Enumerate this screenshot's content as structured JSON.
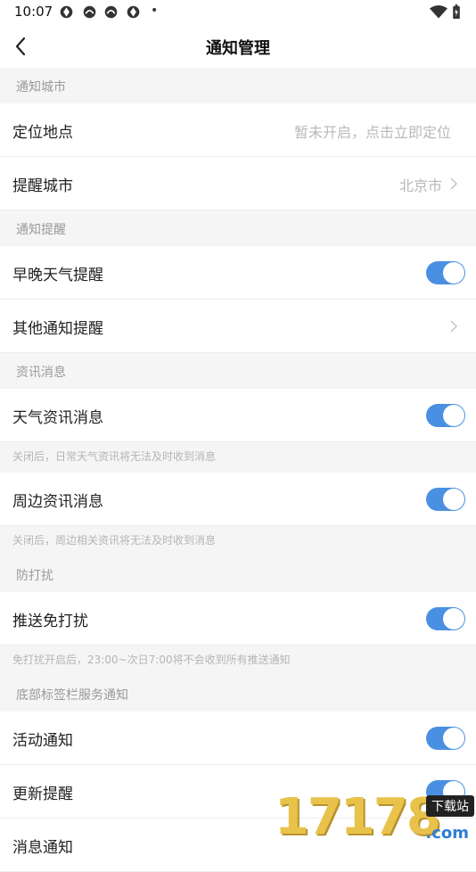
{
  "status_bar": {
    "time": "10:07",
    "dot": "•"
  },
  "header": {
    "title": "通知管理"
  },
  "sections": [
    {
      "title": "通知城市"
    },
    {
      "title": "通知提醒"
    },
    {
      "title": "资讯消息"
    },
    {
      "title": "防打扰"
    },
    {
      "title": "底部标签栏服务通知"
    }
  ],
  "rows": {
    "location": {
      "label": "定位地点",
      "value": "暂未开启，点击立即定位"
    },
    "reminder_city": {
      "label": "提醒城市",
      "value": "北京市"
    },
    "weather_reminder": {
      "label": "早晚天气提醒",
      "on": true
    },
    "other_reminder": {
      "label": "其他通知提醒"
    },
    "weather_news": {
      "label": "天气资讯消息",
      "on": true,
      "note": "关闭后，日常天气资讯将无法及时收到消息"
    },
    "nearby_news": {
      "label": "周边资讯消息",
      "on": true,
      "note": "关闭后，周边相关资讯将无法及时收到消息"
    },
    "push_dnd": {
      "label": "推送免打扰",
      "on": true,
      "note": "免打扰开启后，23:00~次日7:00将不会收到所有推送通知"
    },
    "activity": {
      "label": "活动通知",
      "on": true
    },
    "update": {
      "label": "更新提醒",
      "on": true
    },
    "message": {
      "label": "消息通知"
    }
  },
  "watermark": {
    "digits": "17178",
    "badge": "下载站",
    "suffix": ".com"
  },
  "colors": {
    "accent": "#4a90e2",
    "background": "#f5f5f5"
  }
}
